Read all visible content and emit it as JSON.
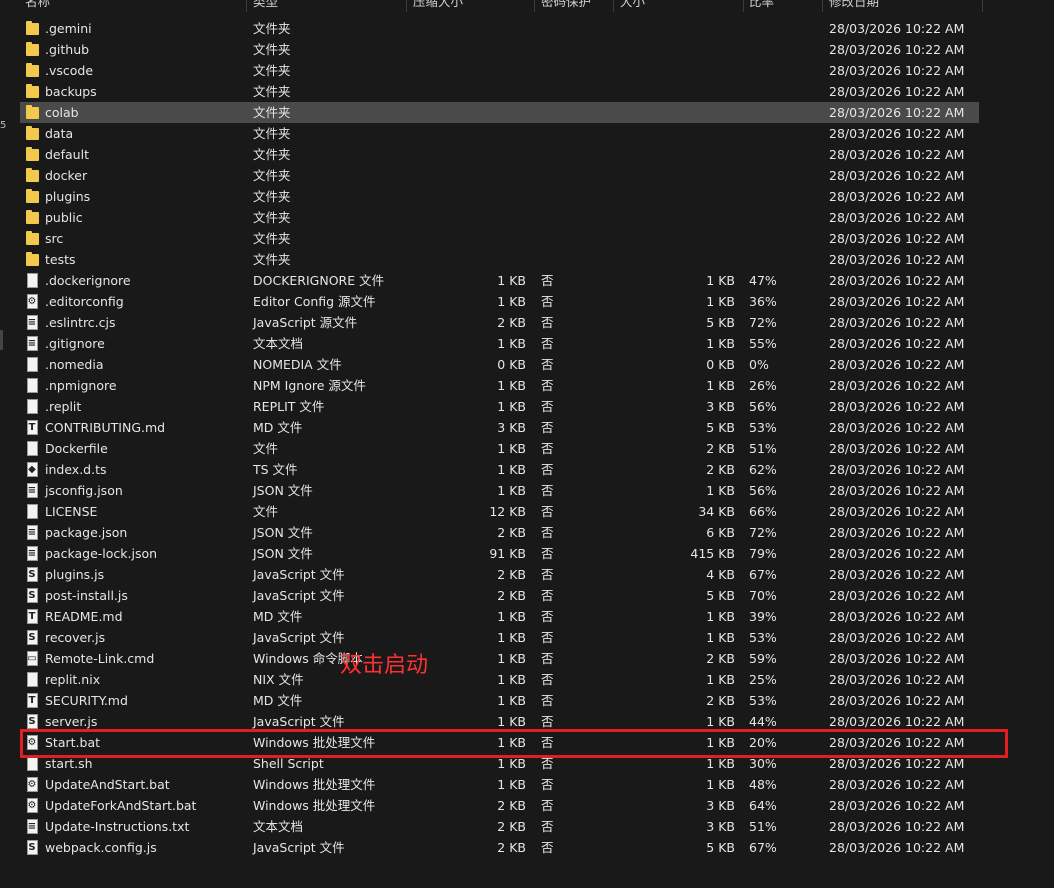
{
  "header": {
    "columns": [
      "名称",
      "类型",
      "压缩大小",
      "密码保护",
      "大小",
      "比率",
      "修改日期"
    ]
  },
  "left_edge_text": "5",
  "annotation": {
    "text": "双击启动",
    "color": "#ff3030"
  },
  "colors": {
    "background": "#191919",
    "selected_row": "#4a4a4a",
    "highlight": "#e02020",
    "folder": "#f2c94c"
  },
  "rows": [
    {
      "name": ".gemini",
      "type": "文件夹",
      "csize": "",
      "enc": "",
      "size": "",
      "ratio": "",
      "date": "28/03/2026 10:22 AM",
      "icon": "folder-icon"
    },
    {
      "name": ".github",
      "type": "文件夹",
      "csize": "",
      "enc": "",
      "size": "",
      "ratio": "",
      "date": "28/03/2026 10:22 AM",
      "icon": "folder-icon"
    },
    {
      "name": ".vscode",
      "type": "文件夹",
      "csize": "",
      "enc": "",
      "size": "",
      "ratio": "",
      "date": "28/03/2026 10:22 AM",
      "icon": "folder-icon"
    },
    {
      "name": "backups",
      "type": "文件夹",
      "csize": "",
      "enc": "",
      "size": "",
      "ratio": "",
      "date": "28/03/2026 10:22 AM",
      "icon": "folder-icon"
    },
    {
      "name": "colab",
      "type": "文件夹",
      "csize": "",
      "enc": "",
      "size": "",
      "ratio": "",
      "date": "28/03/2026 10:22 AM",
      "icon": "folder-icon",
      "selected": true
    },
    {
      "name": "data",
      "type": "文件夹",
      "csize": "",
      "enc": "",
      "size": "",
      "ratio": "",
      "date": "28/03/2026 10:22 AM",
      "icon": "folder-icon"
    },
    {
      "name": "default",
      "type": "文件夹",
      "csize": "",
      "enc": "",
      "size": "",
      "ratio": "",
      "date": "28/03/2026 10:22 AM",
      "icon": "folder-icon"
    },
    {
      "name": "docker",
      "type": "文件夹",
      "csize": "",
      "enc": "",
      "size": "",
      "ratio": "",
      "date": "28/03/2026 10:22 AM",
      "icon": "folder-icon"
    },
    {
      "name": "plugins",
      "type": "文件夹",
      "csize": "",
      "enc": "",
      "size": "",
      "ratio": "",
      "date": "28/03/2026 10:22 AM",
      "icon": "folder-icon"
    },
    {
      "name": "public",
      "type": "文件夹",
      "csize": "",
      "enc": "",
      "size": "",
      "ratio": "",
      "date": "28/03/2026 10:22 AM",
      "icon": "folder-icon"
    },
    {
      "name": "src",
      "type": "文件夹",
      "csize": "",
      "enc": "",
      "size": "",
      "ratio": "",
      "date": "28/03/2026 10:22 AM",
      "icon": "folder-icon"
    },
    {
      "name": "tests",
      "type": "文件夹",
      "csize": "",
      "enc": "",
      "size": "",
      "ratio": "",
      "date": "28/03/2026 10:22 AM",
      "icon": "folder-icon"
    },
    {
      "name": ".dockerignore",
      "type": "DOCKERIGNORE 文件",
      "csize": "1 KB",
      "enc": "否",
      "size": "1 KB",
      "ratio": "47%",
      "date": "28/03/2026 10:22 AM",
      "icon": "file-icon"
    },
    {
      "name": ".editorconfig",
      "type": "Editor Config 源文件",
      "csize": "1 KB",
      "enc": "否",
      "size": "1 KB",
      "ratio": "36%",
      "date": "28/03/2026 10:22 AM",
      "icon": "config-file-icon"
    },
    {
      "name": ".eslintrc.cjs",
      "type": "JavaScript 源文件",
      "csize": "2 KB",
      "enc": "否",
      "size": "5 KB",
      "ratio": "72%",
      "date": "28/03/2026 10:22 AM",
      "icon": "source-file-icon"
    },
    {
      "name": ".gitignore",
      "type": "文本文档",
      "csize": "1 KB",
      "enc": "否",
      "size": "1 KB",
      "ratio": "55%",
      "date": "28/03/2026 10:22 AM",
      "icon": "text-file-icon"
    },
    {
      "name": ".nomedia",
      "type": "NOMEDIA 文件",
      "csize": "0 KB",
      "enc": "否",
      "size": "0 KB",
      "ratio": "0%",
      "date": "28/03/2026 10:22 AM",
      "icon": "file-icon"
    },
    {
      "name": ".npmignore",
      "type": "NPM Ignore 源文件",
      "csize": "1 KB",
      "enc": "否",
      "size": "1 KB",
      "ratio": "26%",
      "date": "28/03/2026 10:22 AM",
      "icon": "file-icon"
    },
    {
      "name": ".replit",
      "type": "REPLIT 文件",
      "csize": "1 KB",
      "enc": "否",
      "size": "3 KB",
      "ratio": "56%",
      "date": "28/03/2026 10:22 AM",
      "icon": "file-icon"
    },
    {
      "name": "CONTRIBUTING.md",
      "type": "MD 文件",
      "csize": "3 KB",
      "enc": "否",
      "size": "5 KB",
      "ratio": "53%",
      "date": "28/03/2026 10:22 AM",
      "icon": "markdown-file-icon"
    },
    {
      "name": "Dockerfile",
      "type": "文件",
      "csize": "1 KB",
      "enc": "否",
      "size": "2 KB",
      "ratio": "51%",
      "date": "28/03/2026 10:22 AM",
      "icon": "file-icon"
    },
    {
      "name": "index.d.ts",
      "type": "TS 文件",
      "csize": "1 KB",
      "enc": "否",
      "size": "2 KB",
      "ratio": "62%",
      "date": "28/03/2026 10:22 AM",
      "icon": "ts-file-icon"
    },
    {
      "name": "jsconfig.json",
      "type": "JSON 文件",
      "csize": "1 KB",
      "enc": "否",
      "size": "1 KB",
      "ratio": "56%",
      "date": "28/03/2026 10:22 AM",
      "icon": "json-file-icon"
    },
    {
      "name": "LICENSE",
      "type": "文件",
      "csize": "12 KB",
      "enc": "否",
      "size": "34 KB",
      "ratio": "66%",
      "date": "28/03/2026 10:22 AM",
      "icon": "file-icon"
    },
    {
      "name": "package.json",
      "type": "JSON 文件",
      "csize": "2 KB",
      "enc": "否",
      "size": "6 KB",
      "ratio": "72%",
      "date": "28/03/2026 10:22 AM",
      "icon": "json-file-icon"
    },
    {
      "name": "package-lock.json",
      "type": "JSON 文件",
      "csize": "91 KB",
      "enc": "否",
      "size": "415 KB",
      "ratio": "79%",
      "date": "28/03/2026 10:22 AM",
      "icon": "json-file-icon"
    },
    {
      "name": "plugins.js",
      "type": "JavaScript 文件",
      "csize": "2 KB",
      "enc": "否",
      "size": "4 KB",
      "ratio": "67%",
      "date": "28/03/2026 10:22 AM",
      "icon": "js-file-icon"
    },
    {
      "name": "post-install.js",
      "type": "JavaScript 文件",
      "csize": "2 KB",
      "enc": "否",
      "size": "5 KB",
      "ratio": "70%",
      "date": "28/03/2026 10:22 AM",
      "icon": "js-file-icon"
    },
    {
      "name": "README.md",
      "type": "MD 文件",
      "csize": "1 KB",
      "enc": "否",
      "size": "1 KB",
      "ratio": "39%",
      "date": "28/03/2026 10:22 AM",
      "icon": "markdown-file-icon"
    },
    {
      "name": "recover.js",
      "type": "JavaScript 文件",
      "csize": "1 KB",
      "enc": "否",
      "size": "1 KB",
      "ratio": "53%",
      "date": "28/03/2026 10:22 AM",
      "icon": "js-file-icon"
    },
    {
      "name": "Remote-Link.cmd",
      "type": "Windows 命令脚本",
      "csize": "1 KB",
      "enc": "否",
      "size": "2 KB",
      "ratio": "59%",
      "date": "28/03/2026 10:22 AM",
      "icon": "script-file-icon"
    },
    {
      "name": "replit.nix",
      "type": "NIX 文件",
      "csize": "1 KB",
      "enc": "否",
      "size": "1 KB",
      "ratio": "25%",
      "date": "28/03/2026 10:22 AM",
      "icon": "file-icon"
    },
    {
      "name": "SECURITY.md",
      "type": "MD 文件",
      "csize": "1 KB",
      "enc": "否",
      "size": "2 KB",
      "ratio": "53%",
      "date": "28/03/2026 10:22 AM",
      "icon": "markdown-file-icon"
    },
    {
      "name": "server.js",
      "type": "JavaScript 文件",
      "csize": "1 KB",
      "enc": "否",
      "size": "1 KB",
      "ratio": "44%",
      "date": "28/03/2026 10:22 AM",
      "icon": "js-file-icon"
    },
    {
      "name": "Start.bat",
      "type": "Windows 批处理文件",
      "csize": "1 KB",
      "enc": "否",
      "size": "1 KB",
      "ratio": "20%",
      "date": "28/03/2026 10:22 AM",
      "icon": "batch-file-icon"
    },
    {
      "name": "start.sh",
      "type": "Shell Script",
      "csize": "1 KB",
      "enc": "否",
      "size": "1 KB",
      "ratio": "30%",
      "date": "28/03/2026 10:22 AM",
      "icon": "file-icon"
    },
    {
      "name": "UpdateAndStart.bat",
      "type": "Windows 批处理文件",
      "csize": "1 KB",
      "enc": "否",
      "size": "1 KB",
      "ratio": "48%",
      "date": "28/03/2026 10:22 AM",
      "icon": "batch-file-icon"
    },
    {
      "name": "UpdateForkAndStart.bat",
      "type": "Windows 批处理文件",
      "csize": "2 KB",
      "enc": "否",
      "size": "3 KB",
      "ratio": "64%",
      "date": "28/03/2026 10:22 AM",
      "icon": "batch-file-icon"
    },
    {
      "name": "Update-Instructions.txt",
      "type": "文本文档",
      "csize": "2 KB",
      "enc": "否",
      "size": "3 KB",
      "ratio": "51%",
      "date": "28/03/2026 10:22 AM",
      "icon": "text-file-icon"
    },
    {
      "name": "webpack.config.js",
      "type": "JavaScript 文件",
      "csize": "2 KB",
      "enc": "否",
      "size": "5 KB",
      "ratio": "67%",
      "date": "28/03/2026 10:22 AM",
      "icon": "js-file-icon"
    }
  ]
}
